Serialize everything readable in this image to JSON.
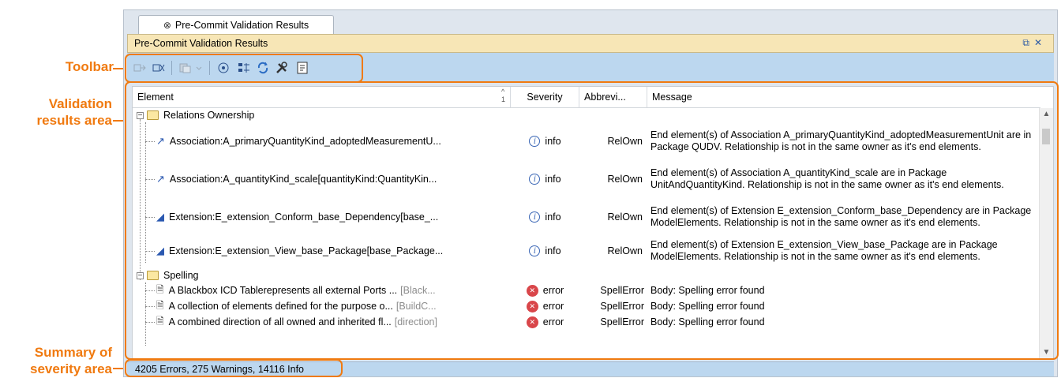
{
  "callouts": {
    "toolbar": "Toolbar",
    "validation_line1": "Validation",
    "validation_line2": "results area",
    "summary_line1": "Summary of",
    "summary_line2": "severity area"
  },
  "colors": {
    "callout": "#f07a10",
    "title_bar": "#f7e6b6",
    "toolbar": "#bcd7ef",
    "error": "#d9464a",
    "info": "#3a66b5"
  },
  "window": {
    "tab_label": "Pre-Commit Validation Results",
    "tab_icon": "validation-icon",
    "title": "Pre-Commit Validation Results",
    "controls": [
      "restore-icon",
      "close-icon"
    ]
  },
  "toolbar": {
    "buttons": [
      {
        "icon": "navigate-to-element-icon",
        "enabled": false
      },
      {
        "icon": "navigate-icon",
        "enabled": true
      },
      {
        "icon": "solve-dropdown-icon",
        "enabled": false
      },
      {
        "icon": "filter-icon",
        "enabled": true
      },
      {
        "icon": "group-icon",
        "enabled": true
      },
      {
        "icon": "refresh-icon",
        "enabled": true
      },
      {
        "icon": "tools-icon",
        "enabled": true
      },
      {
        "icon": "report-icon",
        "enabled": true
      }
    ]
  },
  "table": {
    "columns": {
      "element": "Element",
      "sort_index": "1",
      "severity": "Severity",
      "abbreviation": "Abbrevi...",
      "message": "Message"
    },
    "groups": [
      {
        "name": "Relations Ownership",
        "rows": [
          {
            "icon": "association-icon",
            "element": "Association:A_primaryQuantityKind_adoptedMeasurementU...",
            "severity": "info",
            "abbr": "RelOwn",
            "message": "End element(s) of Association A_primaryQuantityKind_adoptedMeasurementUnit are in Package QUDV. Relationship is not in the same owner as it's end elements."
          },
          {
            "icon": "association-icon",
            "element": "Association:A_quantityKind_scale[quantityKind:QuantityKin...",
            "severity": "info",
            "abbr": "RelOwn",
            "message": "End element(s) of Association A_quantityKind_scale are in Package UnitAndQuantityKind. Relationship is not in the same owner as it's end elements."
          },
          {
            "icon": "extension-icon",
            "element": "Extension:E_extension_Conform_base_Dependency[base_...",
            "severity": "info",
            "abbr": "RelOwn",
            "message": "End element(s) of Extension E_extension_Conform_base_Dependency are in Package ModelElements. Relationship is not in the same owner as it's end elements."
          },
          {
            "icon": "extension-icon",
            "element": "Extension:E_extension_View_base_Package[base_Package...",
            "severity": "info",
            "abbr": "RelOwn",
            "message": "End element(s) of Extension E_extension_View_base_Package are in Package ModelElements. Relationship is not in the same owner as it's end elements."
          }
        ]
      },
      {
        "name": "Spelling",
        "rows": [
          {
            "icon": "comment-icon",
            "element": "A Blackbox ICD Tablerepresents all external Ports ...",
            "suffix": "[Black...",
            "severity": "error",
            "abbr": "SpellError",
            "message": "Body: Spelling error found"
          },
          {
            "icon": "comment-icon",
            "element": "A collection of elements defined for the purpose o...",
            "suffix": "[BuildC...",
            "severity": "error",
            "abbr": "SpellError",
            "message": "Body: Spelling error found"
          },
          {
            "icon": "comment-icon",
            "element": "A combined direction of all owned and inherited fl...",
            "suffix": "[direction]",
            "severity": "error",
            "abbr": "SpellError",
            "message": "Body: Spelling error found"
          }
        ]
      }
    ]
  },
  "status": {
    "summary": "4205 Errors, 275 Warnings, 14116 Info"
  }
}
